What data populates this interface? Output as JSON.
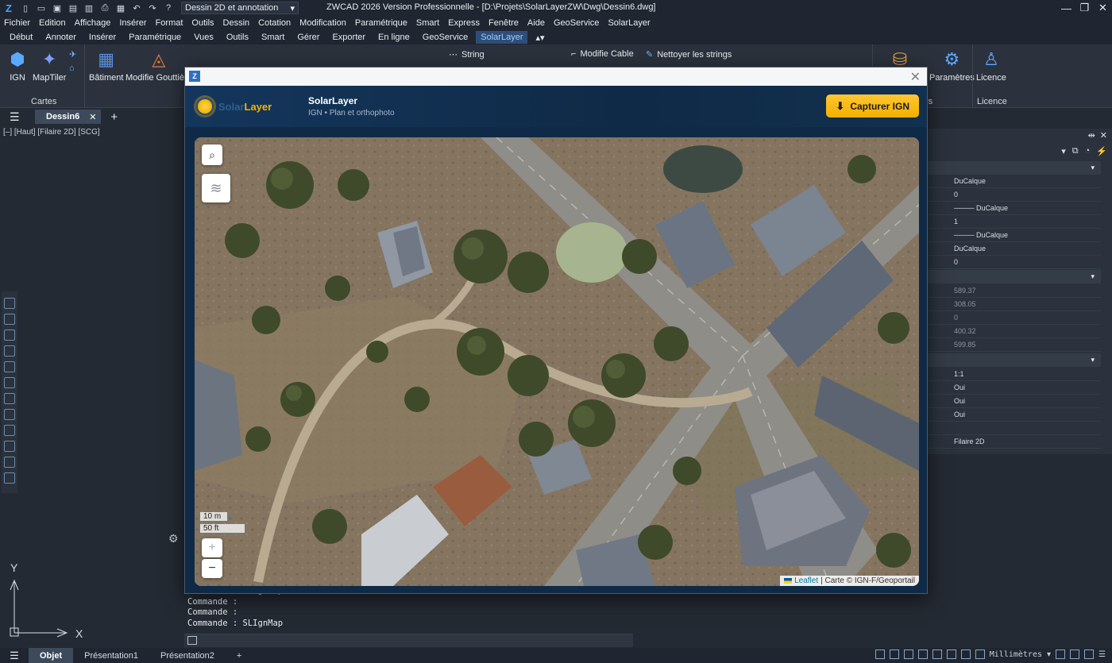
{
  "titlebar": {
    "workspace": "Dessin 2D et annotation",
    "title": "ZWCAD 2026 Version Professionnelle - [D:\\Projets\\SolarLayerZW\\Dwg\\Dessin6.dwg]"
  },
  "menu": [
    "Fichier",
    "Edition",
    "Affichage",
    "Insérer",
    "Format",
    "Outils",
    "Dessin",
    "Cotation",
    "Modification",
    "Paramétrique",
    "Smart",
    "Express",
    "Fenêtre",
    "Aide",
    "GeoService",
    "SolarLayer"
  ],
  "ribbon_tabs": [
    "Début",
    "Annoter",
    "Insérer",
    "Paramétrique",
    "Vues",
    "Outils",
    "Smart",
    "Gérer",
    "Exporter",
    "En ligne",
    "GeoService",
    "SolarLayer"
  ],
  "ribbon_active_tab": "SolarLayer",
  "ribbon": {
    "ign": "IGN",
    "maptiler": "MapTiler",
    "batiment": "Bâtiment",
    "gouttiere": "Modifie Gouttière",
    "cartes_group": "Cartes",
    "string": "String",
    "modifie_cable": "Modifie Cable",
    "nettoyer": "Nettoyer les strings",
    "parametres": "Paramètres",
    "licence": "Licence",
    "licence_group": "Licence",
    "rs_group": "rs"
  },
  "doc_tab": "Dessin6",
  "view_label": "[–] [Haut] [Filaire 2D] [SCG]",
  "ucs": {
    "y": "Y",
    "x": "X"
  },
  "command_lines": [
    "Commande : SLIgnMap",
    "Commande :",
    "Commande :",
    "Commande : SLIgnMap"
  ],
  "properties": {
    "rows1": [
      "DuCalque",
      "0",
      "──── DuCalque",
      "1",
      "──── DuCalque",
      "DuCalque",
      "0"
    ],
    "rows2": [
      "589.37",
      "308.05",
      "0",
      "400.32",
      "599.85"
    ],
    "rows3": [
      "1:1",
      "Oui",
      "Oui",
      "Oui",
      "",
      "Filaire 2D"
    ]
  },
  "status": {
    "tabs": [
      "Objet",
      "Présentation1",
      "Présentation2"
    ],
    "units": "Millimètres"
  },
  "modal": {
    "brand_solar": "Solar",
    "brand_layer": "Layer",
    "title": "SolarLayer",
    "subtitle": "IGN • Plan et orthophoto",
    "capture_label": "Capturer IGN",
    "scale_m": "10 m",
    "scale_ft": "50 ft",
    "zoom_in": "+",
    "zoom_out": "−",
    "attrib_link": "Leaflet",
    "attrib_text": "| Carte © IGN-F/Geoportail"
  },
  "colors": {
    "accent": "#f5b400",
    "brand_blue": "#2f5f92",
    "modal_bg": "#0f2a46",
    "ui_dark": "#242a33"
  }
}
